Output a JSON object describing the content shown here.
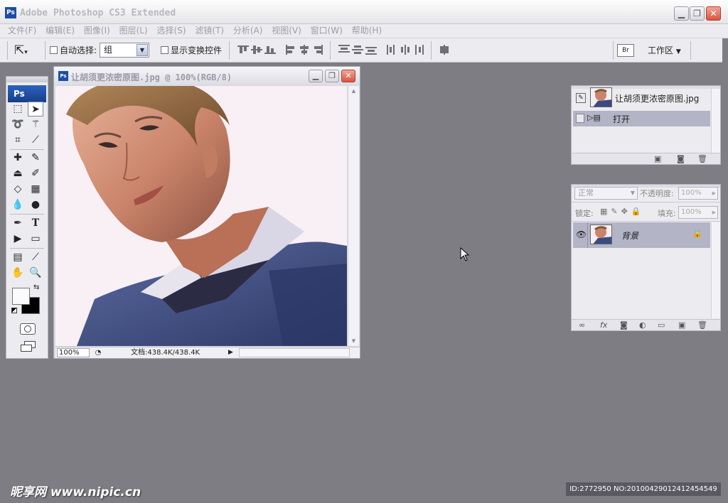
{
  "app": {
    "title": "Adobe Photoshop CS3 Extended",
    "icon_text": "Ps"
  },
  "window_controls": [
    "minimize-icon",
    "maximize-icon",
    "close-icon"
  ],
  "menu": [
    "文件(F)",
    "编辑(E)",
    "图像(I)",
    "图层(L)",
    "选择(S)",
    "滤镜(T)",
    "分析(A)",
    "视图(V)",
    "窗口(W)",
    "帮助(H)"
  ],
  "options": {
    "auto_select_label": "自动选择:",
    "auto_select_checked": false,
    "group_value": "组",
    "show_transform_label": "显示变换控件",
    "show_transform_checked": false,
    "workspace_label": "工作区"
  },
  "toolbox": {
    "header": "Ps"
  },
  "document": {
    "title": "让胡须更浓密原图.jpg @ 100%(RGB/8)",
    "zoom": "100%",
    "doc_info": "文档:438.4K/438.4K"
  },
  "history_panel": {
    "snapshot_name": "让胡须更浓密原图.jpg",
    "state_label": "打开"
  },
  "layers_panel": {
    "blend_mode": "正常",
    "opacity_label": "不透明度:",
    "opacity_value": "100%",
    "lock_label": "锁定:",
    "fill_label": "填充:",
    "fill_value": "100%",
    "layer_name": "背景"
  },
  "watermark": {
    "site": "昵享网 www.nipic.cn",
    "id_text": "ID:2772950 NO:20100429012412454549"
  }
}
